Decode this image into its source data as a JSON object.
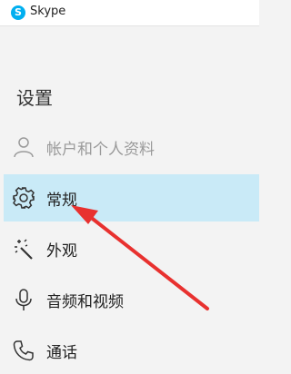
{
  "window": {
    "app_icon_letter": "S",
    "title": "Skype"
  },
  "settings": {
    "title": "设置",
    "items": [
      {
        "label": "帐户和个人资料",
        "icon": "person-icon",
        "selected": false,
        "muted": true
      },
      {
        "label": "常规",
        "icon": "gear-icon",
        "selected": true,
        "muted": false
      },
      {
        "label": "外观",
        "icon": "magic-wand-icon",
        "selected": false,
        "muted": false
      },
      {
        "label": "音频和视频",
        "icon": "microphone-icon",
        "selected": false,
        "muted": false
      },
      {
        "label": "通话",
        "icon": "phone-icon",
        "selected": false,
        "muted": false
      }
    ]
  },
  "colors": {
    "accent": "#00aff0",
    "selected_bg": "#c9eaf7",
    "annotation_arrow": "#e8312f"
  }
}
